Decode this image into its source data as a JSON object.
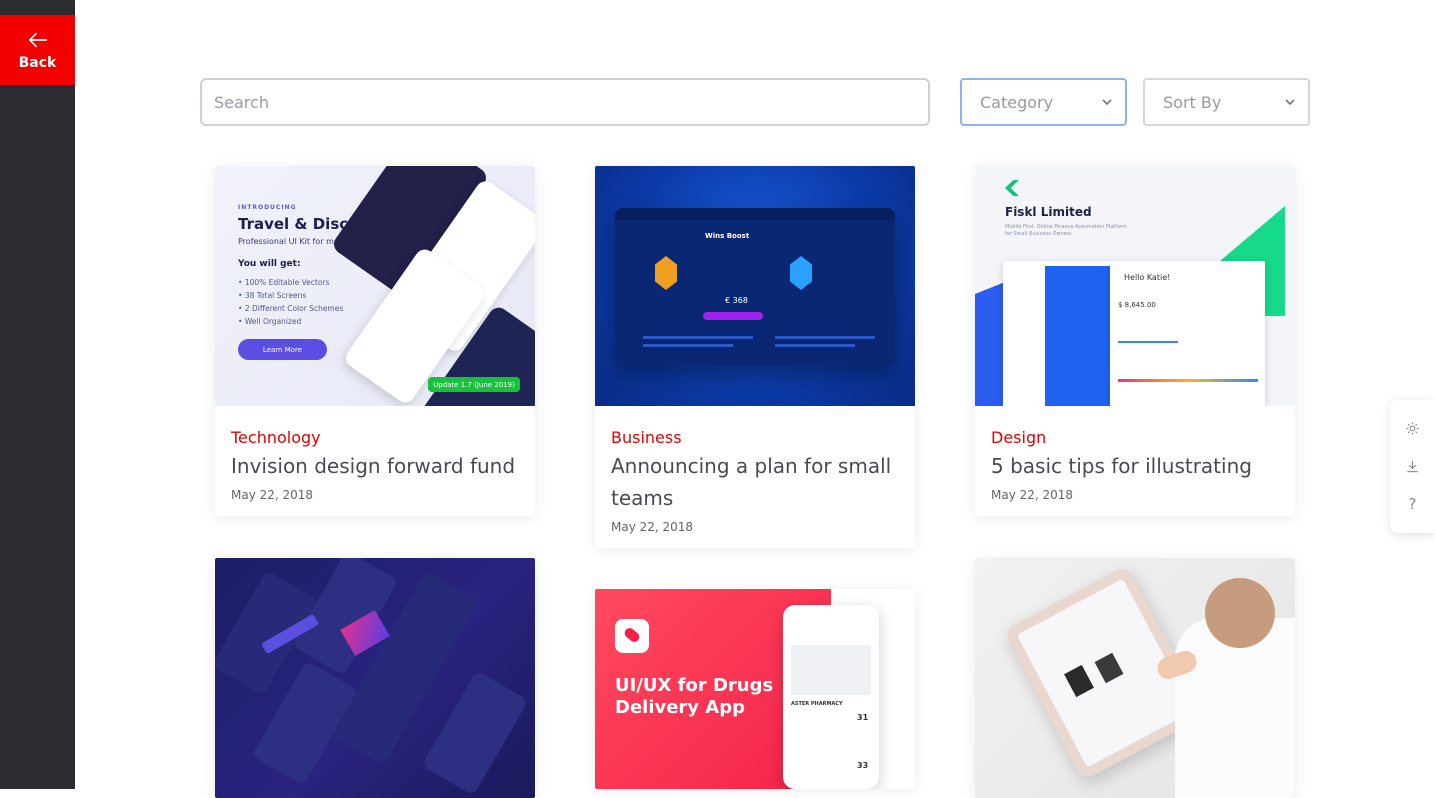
{
  "sidebar": {
    "back_label": "Back"
  },
  "filters": {
    "search_placeholder": "Search",
    "category_label": "Category",
    "sort_label": "Sort By"
  },
  "cards": [
    {
      "category": "Technology",
      "title": "Invision design forward fund",
      "date": "May 22, 2018",
      "image": {
        "intro": "INTRODUCING",
        "heading": "Travel & Discovery",
        "subheading": "Professional UI Kit for mobile devices",
        "list_title": "You will get:",
        "bullets": [
          "100% Editable Vectors",
          "38 Total Screens",
          "2 Different Color Schemes",
          "Well Organized"
        ],
        "cta": "Learn More",
        "badge": "Update 1.7 (June 2019)"
      }
    },
    {
      "category": "Business",
      "title": "Announcing a plan for small teams",
      "date": "May 22, 2018",
      "image": {
        "tab_label": "Wins Boost",
        "amount": "€ 368"
      }
    },
    {
      "category": "Design",
      "title": "5 basic tips for illustrating",
      "date": "May 22, 2018",
      "image": {
        "brand": "Fiskl Limited",
        "tagline": "Mobile First, Online Finance Automation Platform for Small Business Owners",
        "greeting": "Hello Katie!",
        "amount": "$ 8,645.00"
      }
    },
    {
      "category": "",
      "title": "",
      "date": ""
    },
    {
      "category": "",
      "title": "",
      "date": "",
      "image": {
        "heading": "UI/UX for Drugs Delivery App",
        "pharmacy": "ASTER PHARMACY",
        "count1": "31",
        "count2": "33"
      }
    },
    {
      "category": "",
      "title": "",
      "date": ""
    }
  ],
  "colors": {
    "accent": "#f20000",
    "sidebar": "#2b2b31",
    "category": "#e30000"
  },
  "tools": [
    "gear-icon",
    "download-icon",
    "help-icon"
  ]
}
